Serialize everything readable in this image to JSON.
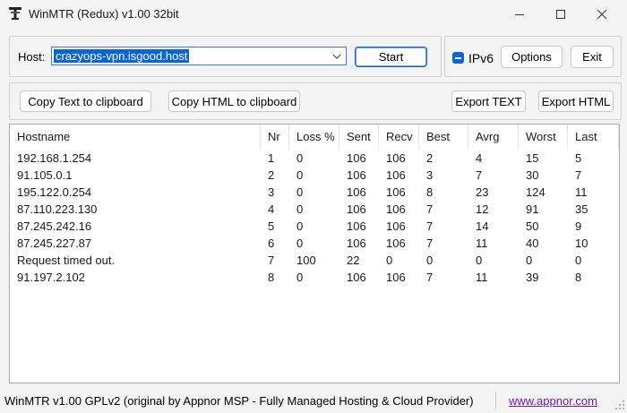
{
  "window": {
    "title": "WinMTR (Redux) v1.00 32bit"
  },
  "host": {
    "label": "Host:",
    "value": "crazyops-vpn.isgood.host"
  },
  "buttons": {
    "start": "Start",
    "options": "Options",
    "exit": "Exit",
    "copy_text": "Copy Text to clipboard",
    "copy_html": "Copy HTML to clipboard",
    "export_text": "Export TEXT",
    "export_html": "Export HTML"
  },
  "ipv6": {
    "label": "IPv6",
    "state": "indeterminate"
  },
  "table": {
    "columns": [
      "Hostname",
      "Nr",
      "Loss %",
      "Sent",
      "Recv",
      "Best",
      "Avrg",
      "Worst",
      "Last"
    ],
    "rows": [
      [
        "192.168.1.254",
        "1",
        "0",
        "106",
        "106",
        "2",
        "4",
        "15",
        "5"
      ],
      [
        "91.105.0.1",
        "2",
        "0",
        "106",
        "106",
        "3",
        "7",
        "30",
        "7"
      ],
      [
        "195.122.0.254",
        "3",
        "0",
        "106",
        "106",
        "8",
        "23",
        "124",
        "11"
      ],
      [
        "87.110.223.130",
        "4",
        "0",
        "106",
        "106",
        "7",
        "12",
        "91",
        "35"
      ],
      [
        "87.245.242.16",
        "5",
        "0",
        "106",
        "106",
        "7",
        "14",
        "50",
        "9"
      ],
      [
        "87.245.227.87",
        "6",
        "0",
        "106",
        "106",
        "7",
        "11",
        "40",
        "10"
      ],
      [
        "Request timed out.",
        "7",
        "100",
        "22",
        "0",
        "0",
        "0",
        "0",
        "0"
      ],
      [
        "91.197.2.102",
        "8",
        "0",
        "106",
        "106",
        "7",
        "11",
        "39",
        "8"
      ]
    ]
  },
  "status": {
    "text": "WinMTR v1.00 GPLv2 (original by Appnor MSP - Fully Managed Hosting & Cloud Provider)",
    "link": "www.appnor.com"
  },
  "colors": {
    "accent": "#0a64d6",
    "link": "#6a1ea8"
  }
}
